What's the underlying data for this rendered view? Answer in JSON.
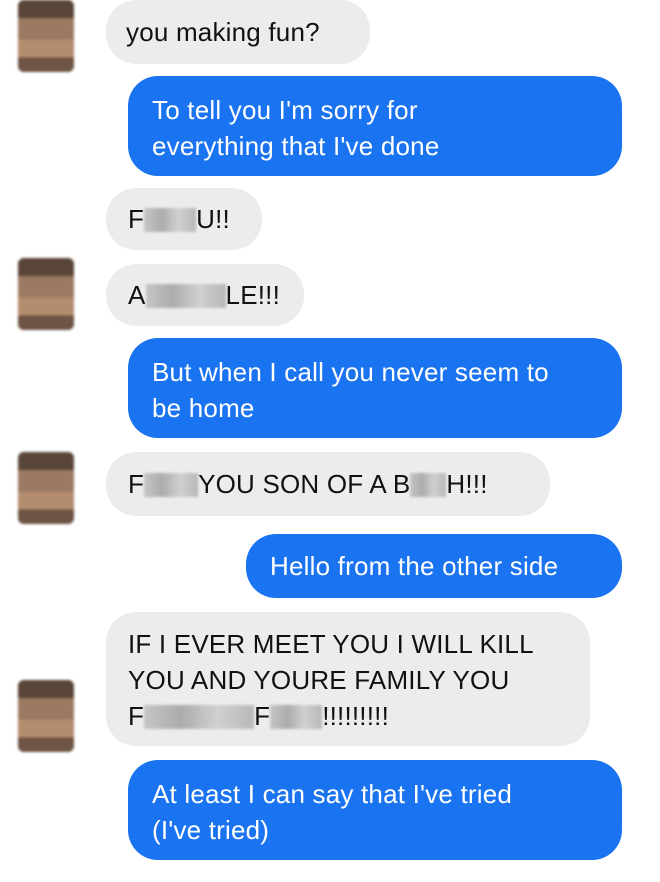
{
  "colors": {
    "incoming_bubble": "#ececec",
    "outgoing_bubble": "#1a73f0",
    "incoming_text": "#111111",
    "outgoing_text": "#ffffff"
  },
  "avatar": {
    "icon": "contact-avatar-icon",
    "blurred": true
  },
  "messages": [
    {
      "side": "incoming",
      "parts": [
        "you making fun?"
      ]
    },
    {
      "side": "outgoing",
      "lines": [
        "To tell you I'm sorry for",
        "everything that I've done"
      ]
    },
    {
      "side": "incoming",
      "parts": [
        "F",
        "U!!"
      ]
    },
    {
      "side": "incoming",
      "parts": [
        "A",
        "LE!!!"
      ]
    },
    {
      "side": "outgoing",
      "lines": [
        "But when I call you never seem to",
        "be home"
      ]
    },
    {
      "side": "incoming",
      "parts": [
        "F",
        "YOU SON OF A B",
        "H!!!"
      ]
    },
    {
      "side": "outgoing",
      "lines": [
        "Hello from the other side"
      ]
    },
    {
      "side": "incoming",
      "lines": [
        "IF I EVER MEET YOU I WILL KILL",
        "YOU AND YOURE FAMILY YOU"
      ],
      "last_parts": [
        "F",
        "F",
        "!!!!!!!!!"
      ]
    },
    {
      "side": "outgoing",
      "lines": [
        "At least I can say that I've tried",
        "(I've tried)"
      ]
    }
  ]
}
